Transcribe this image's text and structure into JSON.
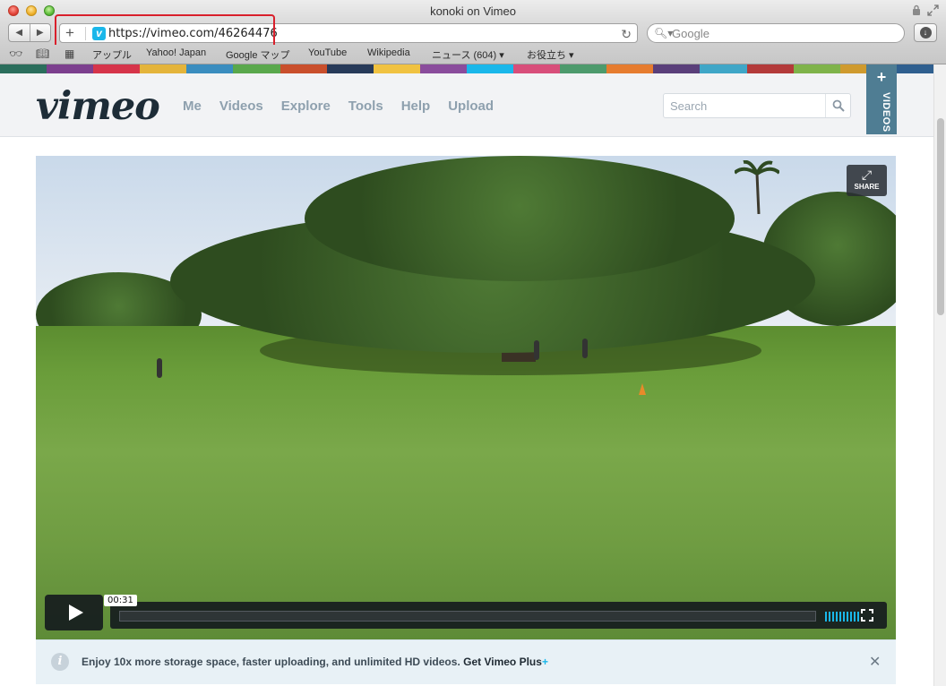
{
  "window": {
    "title": "konoki on Vimeo"
  },
  "toolbar": {
    "back_icon": "back-arrow-icon",
    "forward_icon": "forward-arrow-icon",
    "url": "https://vimeo.com/46264476",
    "favicon_letter": "v",
    "search_placeholder": "Google"
  },
  "bookmarks": {
    "items": [
      {
        "label": "アップル"
      },
      {
        "label": "Yahoo! Japan"
      },
      {
        "label": "Google マップ"
      },
      {
        "label": "YouTube"
      },
      {
        "label": "Wikipedia"
      },
      {
        "label": "ニュース (604) ▾"
      },
      {
        "label": "お役立ち ▾"
      }
    ]
  },
  "colors": {
    "vimeo_blue": "#1ab7ea",
    "logo_dark": "#1d2c37",
    "nav_gray": "#8ea0ae",
    "videos_tab": "#4f7d93",
    "strip": [
      "#2b6e5c",
      "#7c3f8e",
      "#d6344a",
      "#e4b43b",
      "#3a8dbf",
      "#5aa84c",
      "#c94f2c",
      "#273a59",
      "#f0c241",
      "#8a4c9c",
      "#1ab7ea",
      "#d84e7a",
      "#4d9a6c",
      "#e67c2f",
      "#5a3f7a",
      "#3fa6c7",
      "#b33a3a",
      "#7fb34a",
      "#cf9a2e",
      "#2f5f8f"
    ]
  },
  "header": {
    "logo": "vimeo",
    "nav": [
      "Me",
      "Videos",
      "Explore",
      "Tools",
      "Help",
      "Upload"
    ],
    "search_placeholder": "Search",
    "videos_tab_plus": "+",
    "videos_tab_label": "VIDEOS"
  },
  "video": {
    "share_label": "SHARE",
    "time": "00:31",
    "volume_bars": 10
  },
  "upsell": {
    "info": "i",
    "message": "Enjoy 10x more storage space, faster uploading, and unlimited HD videos.",
    "link": "Get Vimeo Plus",
    "plus": "+",
    "close": "✕"
  }
}
